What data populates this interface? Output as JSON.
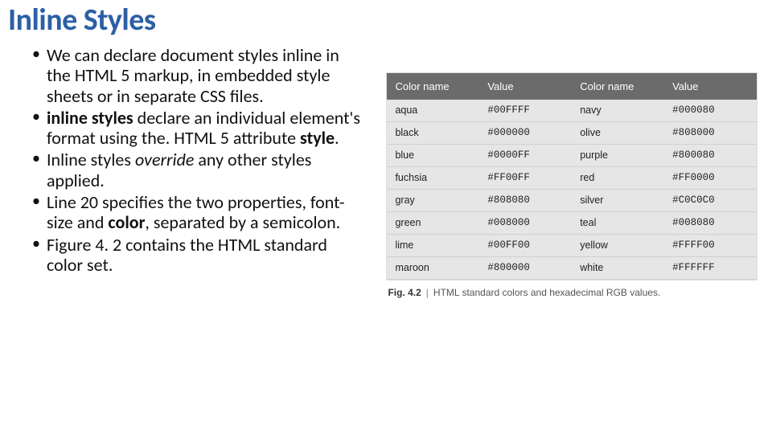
{
  "title": "Inline Styles",
  "bullets": {
    "b1a": "We can declare document styles inline in the HTML 5 markup, in embedded style sheets or in separate CSS files.",
    "b2_bold1": "inline styles",
    "b2_mid": " declare an individual element's format using the. HTML 5 attribute ",
    "b2_bold2": "style",
    "b2_end": ".",
    "b3a": "Inline styles ",
    "b3_ital": "override",
    "b3b": " any other styles applied.",
    "b4a": "Line 20 specifies the two properties, font-size and ",
    "b4_bold": "color",
    "b4b": ", separated by a semicolon.",
    "b5": "Figure 4. 2 contains the HTML standard color set."
  },
  "figure": {
    "headers": {
      "h1": "Color name",
      "h2": "Value",
      "h3": "Color name",
      "h4": "Value"
    },
    "rows": [
      {
        "n1": "aqua",
        "v1": "#00FFFF",
        "n2": "navy",
        "v2": "#000080"
      },
      {
        "n1": "black",
        "v1": "#000000",
        "n2": "olive",
        "v2": "#808000"
      },
      {
        "n1": "blue",
        "v1": "#0000FF",
        "n2": "purple",
        "v2": "#800080"
      },
      {
        "n1": "fuchsia",
        "v1": "#FF00FF",
        "n2": "red",
        "v2": "#FF0000"
      },
      {
        "n1": "gray",
        "v1": "#808080",
        "n2": "silver",
        "v2": "#C0C0C0"
      },
      {
        "n1": "green",
        "v1": "#008000",
        "n2": "teal",
        "v2": "#008080"
      },
      {
        "n1": "lime",
        "v1": "#00FF00",
        "n2": "yellow",
        "v2": "#FFFF00"
      },
      {
        "n1": "maroon",
        "v1": "#800000",
        "n2": "white",
        "v2": "#FFFFFF"
      }
    ],
    "caption_num": "Fig. 4.2",
    "caption_text": "HTML standard colors and hexadecimal RGB values."
  }
}
